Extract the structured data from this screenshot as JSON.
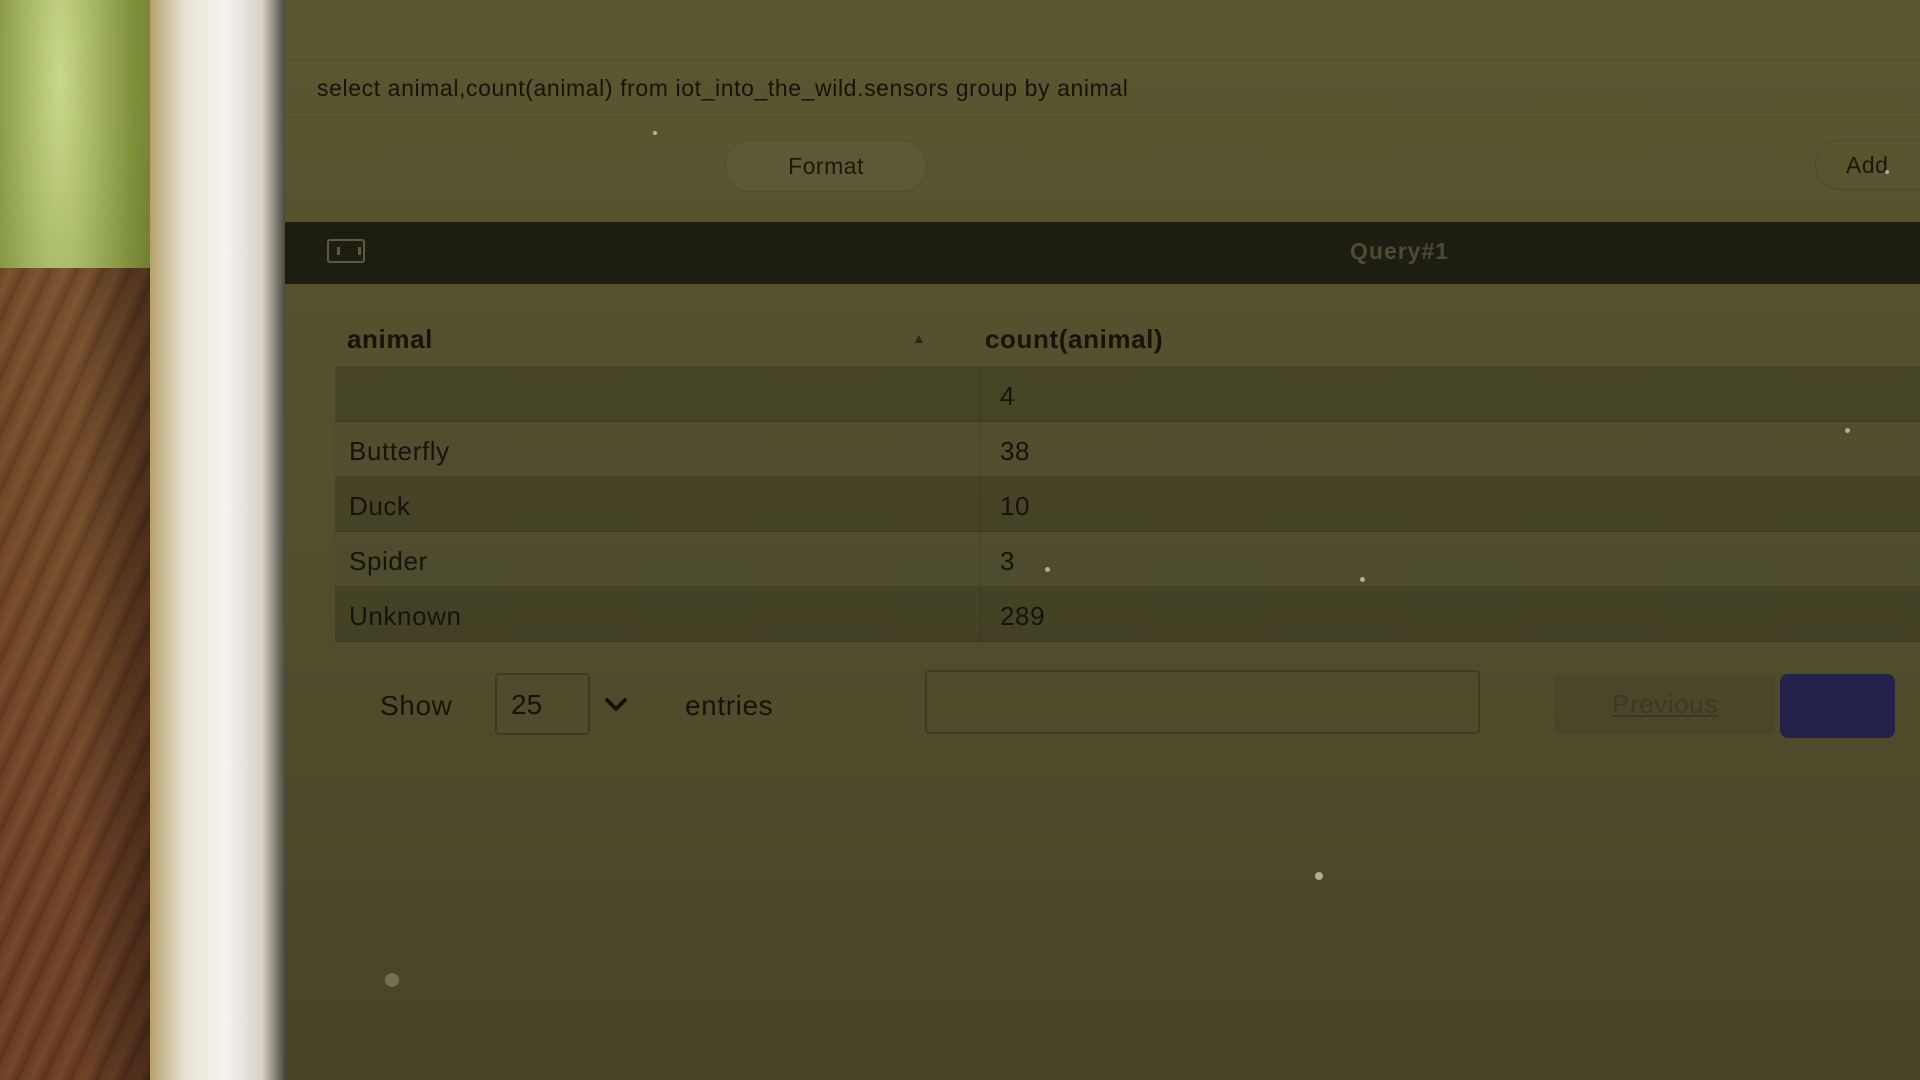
{
  "editor": {
    "query_text": "select animal,count(animal) from iot_into_the_wild.sensors group by animal",
    "format_label": "Format",
    "add_label": "Add"
  },
  "result_panel": {
    "title": "Query#1",
    "icon": "chart-box-icon",
    "columns": [
      "animal",
      "count(animal)"
    ],
    "sort_icon": "sort-up-icon",
    "rows": [
      {
        "animal": "",
        "count": "4"
      },
      {
        "animal": "Butterfly",
        "count": "38"
      },
      {
        "animal": "Duck",
        "count": "10"
      },
      {
        "animal": "Spider",
        "count": "3"
      },
      {
        "animal": "Unknown",
        "count": "289"
      }
    ]
  },
  "pagination": {
    "show_label": "Show",
    "page_size": "25",
    "entries_label": "entries",
    "search_value": "",
    "previous_label": "Previous",
    "current_page": ""
  },
  "colors": {
    "page_button": "#22224a",
    "query_bar": "#1e1d12"
  }
}
